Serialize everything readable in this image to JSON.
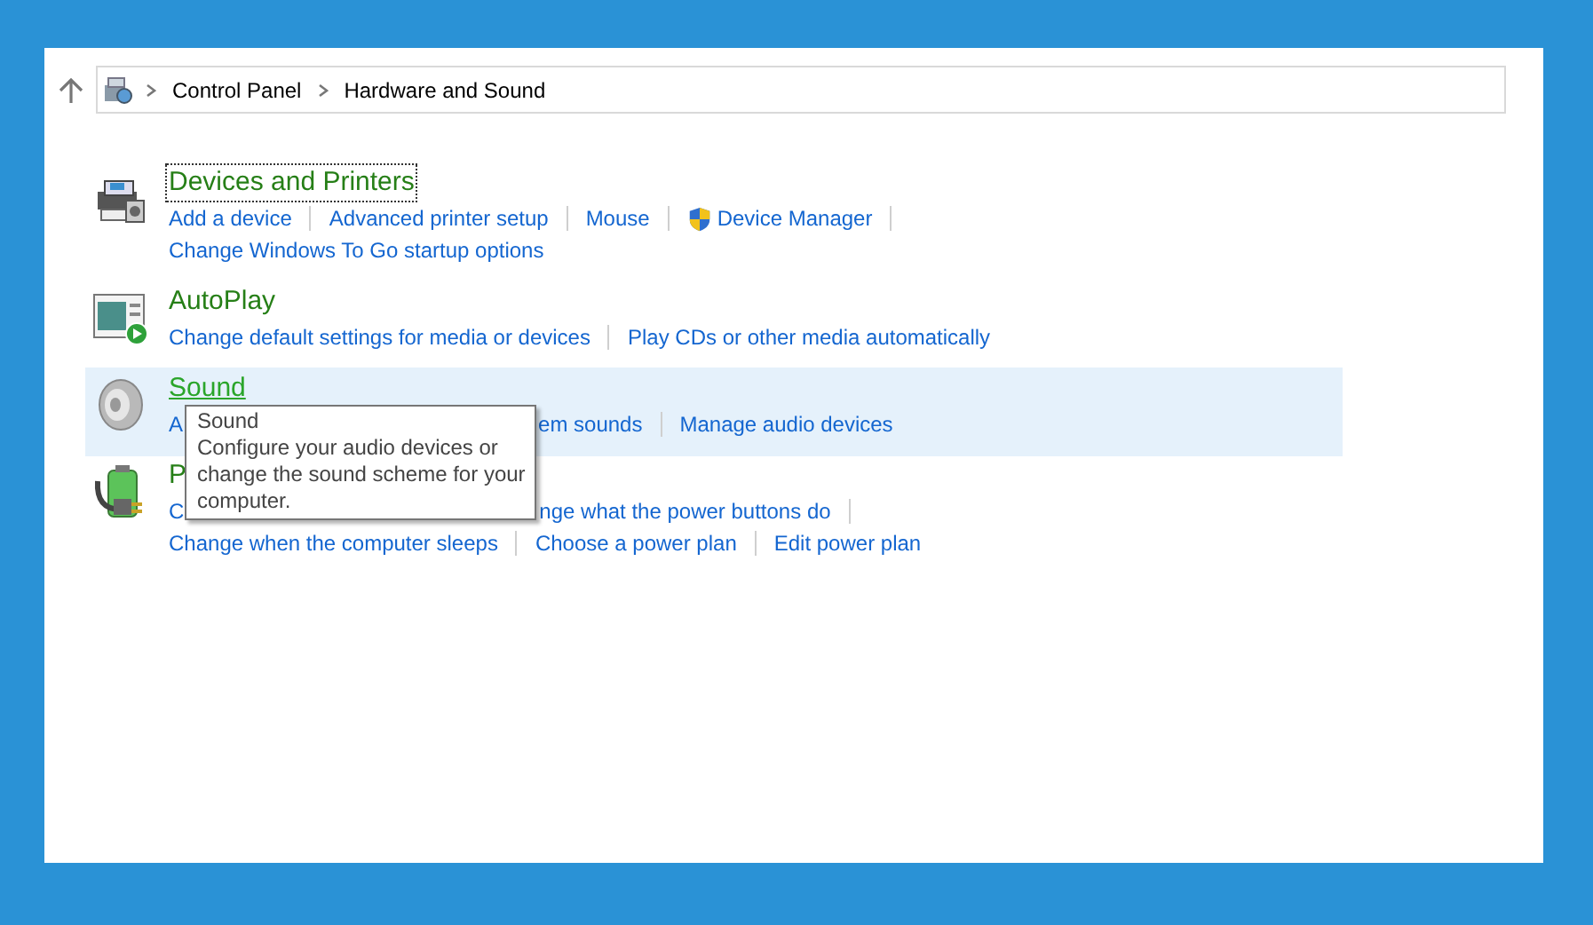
{
  "breadcrumb": [
    {
      "label": "Control Panel"
    },
    {
      "label": "Hardware and Sound"
    }
  ],
  "sections": [
    {
      "title": "Devices and Printers",
      "focused": true,
      "hovered": false,
      "lines": [
        [
          {
            "text": "Add a device",
            "sep": true
          },
          {
            "text": "Advanced printer setup",
            "sep": true
          },
          {
            "text": "Mouse",
            "sep": true
          },
          {
            "text": "Device Manager",
            "shield": true,
            "sep": true
          }
        ],
        [
          {
            "text": "Change Windows To Go startup options",
            "sep": false
          }
        ]
      ]
    },
    {
      "title": "AutoPlay",
      "focused": false,
      "hovered": false,
      "lines": [
        [
          {
            "text": "Change default settings for media or devices",
            "sep": true
          },
          {
            "text": "Play CDs or other media automatically",
            "sep": false
          }
        ]
      ]
    },
    {
      "title": "Sound",
      "focused": false,
      "hovered": true,
      "lines": [
        [
          {
            "text": "A",
            "sep": false
          },
          {
            "text": "em sounds",
            "after_tooltip": true,
            "sep": true
          },
          {
            "text": "Manage audio devices",
            "sep": false
          }
        ]
      ]
    },
    {
      "title": "P",
      "focused": false,
      "hovered": false,
      "lines": [
        [
          {
            "text": "C",
            "sep": false
          },
          {
            "text": "nge what the power buttons do",
            "after_tooltip": true,
            "sep": true
          }
        ],
        [
          {
            "text": "Change when the computer sleeps",
            "sep": true
          },
          {
            "text": "Choose a power plan",
            "sep": true
          },
          {
            "text": "Edit power plan",
            "sep": false
          }
        ]
      ]
    }
  ],
  "tooltip": {
    "title": "Sound",
    "text": "Configure your audio devices or change the sound scheme for your computer."
  }
}
